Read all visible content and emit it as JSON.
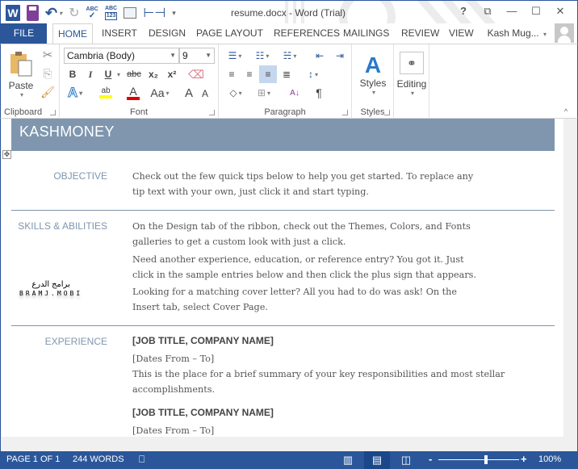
{
  "window": {
    "title": "resume.docx - Word (Trial)",
    "help": "?",
    "controls": {
      "restore_ribbon": "⧉",
      "minimize": "—",
      "maximize": "☐",
      "close": "✕"
    }
  },
  "qat": {
    "word_logo": "W",
    "undo": "↶",
    "undo_caret": "▾",
    "redo": "↻",
    "spelling": "ABC✓",
    "word_count": "ABC 123",
    "customize": "▾"
  },
  "tabs": [
    "FILE",
    "HOME",
    "INSERT",
    "DESIGN",
    "PAGE LAYOUT",
    "REFERENCES",
    "MAILINGS",
    "REVIEW",
    "VIEW"
  ],
  "active_tab": "HOME",
  "user": {
    "name": "Kash Mug...",
    "caret": "▾"
  },
  "ribbon": {
    "clipboard": {
      "label": "Clipboard",
      "paste": "Paste"
    },
    "font": {
      "label": "Font",
      "font_name": "Cambria (Body)",
      "font_size": "9",
      "bold": "B",
      "italic": "I",
      "underline": "U",
      "strike": "abc",
      "subscript": "x₂",
      "superscript": "x²",
      "text_effects": "A",
      "highlight": "ab",
      "font_color": "A",
      "change_case": "Aa",
      "grow": "A",
      "shrink": "A",
      "highlight_color": "#ffff00",
      "font_color_value": "#e00000"
    },
    "paragraph": {
      "label": "Paragraph",
      "show_marks": "¶",
      "sort": "A↓",
      "active_align": "align-right"
    },
    "styles": {
      "label": "Styles",
      "button": "Styles"
    },
    "editing": {
      "button": "Editing"
    }
  },
  "document": {
    "name": "KASHMONEY",
    "sections": [
      {
        "label": "OBJECTIVE",
        "lines": [
          "Check out the few quick tips below to help you get started. To replace any",
          "tip text with your own, just click it and start typing."
        ]
      },
      {
        "label": "SKILLS & ABILITIES",
        "lines": [
          "On the Design tab of the ribbon, check out the Themes, Colors, and Fonts",
          "galleries to get a custom look with just a click.",
          "Need another experience, education, or reference entry? You got it. Just",
          "click in the sample entries below and then click the plus sign that appears.",
          "Looking for a matching cover letter? All you had to do was ask! On the",
          "Insert tab, select Cover Page."
        ]
      },
      {
        "label": "EXPERIENCE",
        "lines": [
          "[JOB TITLE, COMPANY NAME]",
          "[Dates From – To]",
          "This is the place for a brief summary of your key responsibilities and most stellar",
          "accomplishments.",
          "[JOB TITLE, COMPANY NAME]",
          "[Dates From – To]"
        ]
      }
    ],
    "watermark": {
      "ar": "برامج الدرع",
      "en": "BRAMJ.MOBI"
    },
    "accent": "#7f96ae"
  },
  "status": {
    "page": "PAGE 1 OF 1",
    "words": "244 WORDS",
    "zoom_minus": "-",
    "zoom_plus": "+",
    "zoom": "100%",
    "zoom_percent": 100
  }
}
